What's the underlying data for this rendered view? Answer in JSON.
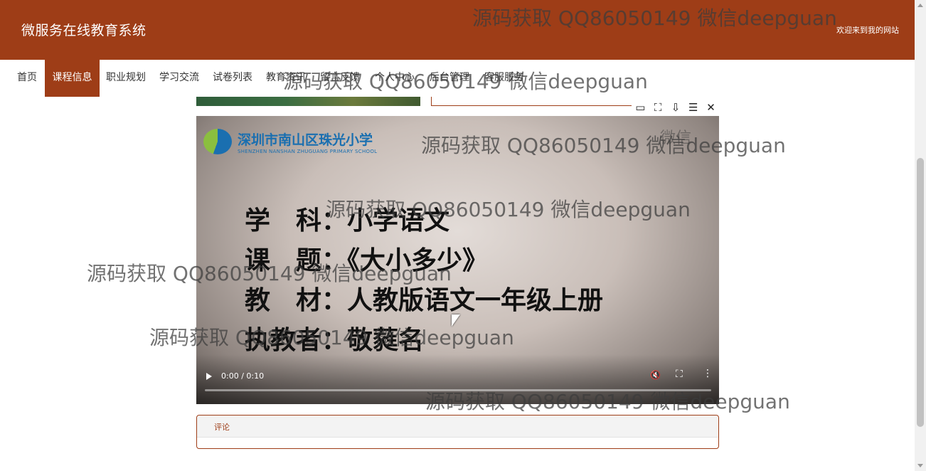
{
  "header": {
    "site_title": "微服务在线教育系统",
    "welcome": "欢迎来到我的网站"
  },
  "nav": {
    "items": [
      {
        "label": "首页",
        "active": false
      },
      {
        "label": "课程信息",
        "active": true
      },
      {
        "label": "职业规划",
        "active": false
      },
      {
        "label": "学习交流",
        "active": false
      },
      {
        "label": "试卷列表",
        "active": false
      },
      {
        "label": "教育资讯",
        "active": false
      },
      {
        "label": "留言反馈",
        "active": false
      },
      {
        "label": "个人中心",
        "active": false
      },
      {
        "label": "后台管理",
        "active": false
      },
      {
        "label": "客服服务",
        "active": false
      }
    ]
  },
  "video": {
    "school_name_cn": "深圳市南山区珠光小学",
    "school_name_en": "SHENZHEN NANSHAN ZHUGUANG PRIMARY SCHOOL",
    "lines": [
      "学　科：小学语文",
      "课　题：《大小多少》",
      "教　材：人教版语文一年级上册",
      "执教者：敬蕤名"
    ],
    "time_display": "0:00 / 0:10",
    "progress": 0
  },
  "pip_toolbar": {
    "icons": [
      "video-camera-icon",
      "fit-screen-icon",
      "download-icon",
      "menu-icon",
      "close-icon"
    ]
  },
  "comments": {
    "label": "评论"
  },
  "watermark": {
    "text": "源码获取 QQ86050149 微信deepguan",
    "extra": "微信"
  },
  "colors": {
    "brand": "#9e3d17",
    "header_text": "#ffffff"
  }
}
